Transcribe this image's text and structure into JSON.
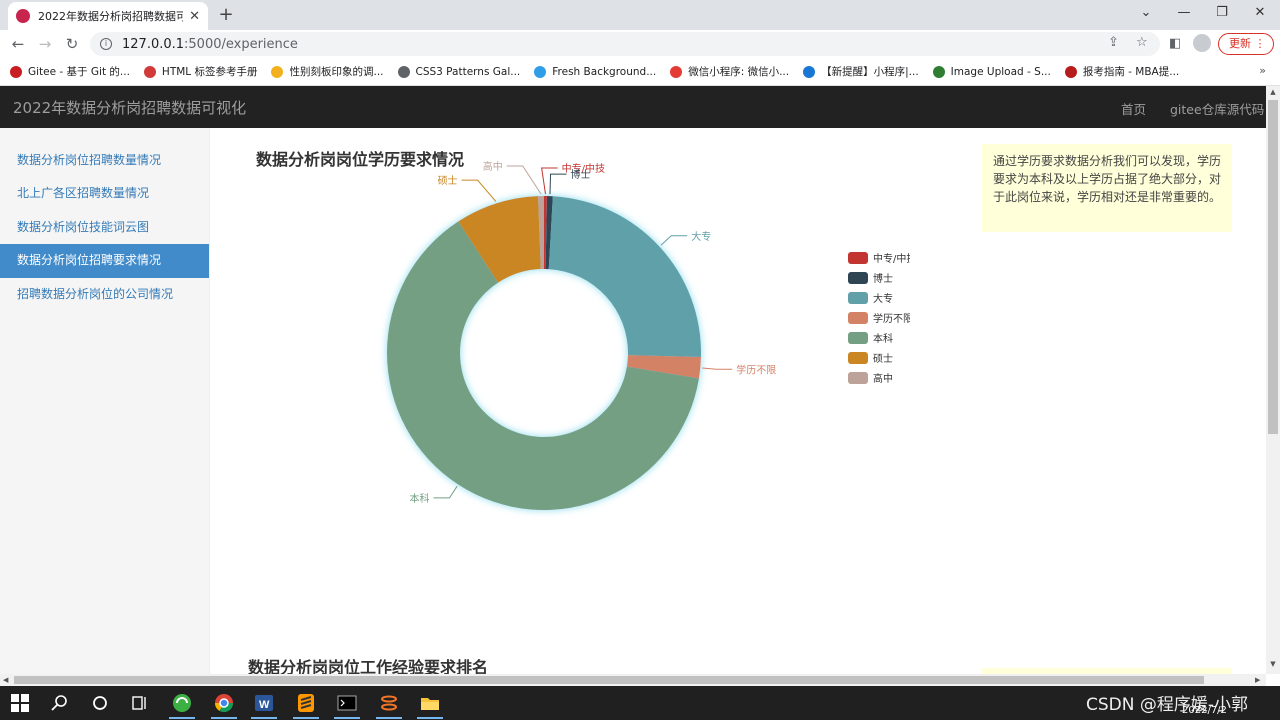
{
  "browser": {
    "tab_title": "2022年数据分析岗招聘数据可视",
    "url_host": "127.0.0.1",
    "url_rest": ":5000/experience",
    "update_label": "更新",
    "bookmarks": [
      {
        "label": "Gitee - 基于 Git 的...",
        "icon": "gitee-icon",
        "color": "#c71d23"
      },
      {
        "label": "HTML 标签参考手册",
        "icon": "html-ref-icon",
        "color": "#d23a3a"
      },
      {
        "label": "性别刻板印象的调...",
        "icon": "star-bookmark-icon",
        "color": "#f2b01e"
      },
      {
        "label": "CSS3 Patterns Gal...",
        "icon": "globe-icon",
        "color": "#5f6368"
      },
      {
        "label": "Fresh Background...",
        "icon": "fresh-bg-icon",
        "color": "#2f9ee8"
      },
      {
        "label": "微信小程序: 微信小...",
        "icon": "wechat-mp-icon",
        "color": "#e53935"
      },
      {
        "label": "【新提醒】小程序|...",
        "icon": "diamond-icon",
        "color": "#1976d2"
      },
      {
        "label": "Image Upload - S...",
        "icon": "bar-chart-icon",
        "color": "#2e7d32"
      },
      {
        "label": "报考指南 - MBA提...",
        "icon": "mba-icon",
        "color": "#b71c1c"
      }
    ]
  },
  "app": {
    "brand": "2022年数据分析岗招聘数据可视化",
    "nav": {
      "home": "首页",
      "repo": "gitee仓库源代码"
    },
    "sidebar": [
      {
        "label": "数据分析岗位招聘数量情况",
        "active": false
      },
      {
        "label": "北上广各区招聘数量情况",
        "active": false
      },
      {
        "label": "数据分析岗位技能词云图",
        "active": false
      },
      {
        "label": "数据分析岗位招聘要求情况",
        "active": true
      },
      {
        "label": "招聘数据分析岗位的公司情况",
        "active": false
      }
    ],
    "section1_title": "数据分析岗岗位学历要求情况",
    "section1_note": "通过学历要求数据分析我们可以发现，学历要求为本科及以上学历占据了绝大部分，对于此岗位来说，学历相对还是非常重要的。",
    "section2_title": "数据分析岗岗位工作经验要求排名"
  },
  "chart_data": {
    "type": "pie",
    "donut": true,
    "title": "数据分析岗岗位学历要求情况",
    "legend_position": "right",
    "slices": [
      {
        "name": "中专/中技",
        "value": 0.3,
        "color": "#c23531"
      },
      {
        "name": "博士",
        "value": 0.6,
        "color": "#2f4554"
      },
      {
        "name": "大专",
        "value": 24.5,
        "color": "#61a0a8"
      },
      {
        "name": "学历不限",
        "value": 2.2,
        "color": "#d48265"
      },
      {
        "name": "本科",
        "value": 63.2,
        "color": "#749f83"
      },
      {
        "name": "硕士",
        "value": 8.6,
        "color": "#ca8622"
      },
      {
        "name": "高中",
        "value": 0.6,
        "color": "#bda29a"
      }
    ]
  },
  "footer": {
    "watermark": "CSDN @程序媛-小郭",
    "tray_date": "2022/7/2"
  }
}
